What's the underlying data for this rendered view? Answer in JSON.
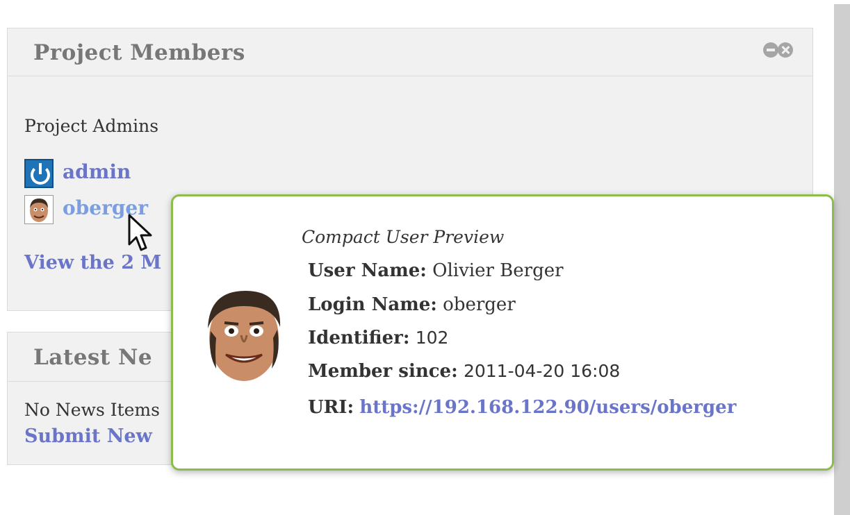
{
  "members_panel": {
    "title": "Project Members",
    "section_label": "Project Admins",
    "members": [
      {
        "name": "admin",
        "avatar": "power-icon"
      },
      {
        "name": "oberger",
        "avatar": "user-photo"
      }
    ],
    "view_all_label": "View the 2 M"
  },
  "news_panel": {
    "title": "Latest Ne",
    "empty_text": "No News Items",
    "submit_label": "Submit New"
  },
  "user_preview": {
    "heading": "Compact User Preview",
    "fields": {
      "user_name_label": "User Name:",
      "user_name_value": "Olivier Berger",
      "login_name_label": "Login Name:",
      "login_name_value": "oberger",
      "identifier_label": "Identifier:",
      "identifier_value": "102",
      "member_since_label": "Member since:",
      "member_since_value": "2011-04-20 16:08",
      "uri_label": "URI:",
      "uri_value": "https://192.168.122.90/users/oberger"
    }
  },
  "colors": {
    "link": "#6a74c8",
    "popup_border": "#8cbc4a",
    "panel_bg": "#f1f1f1"
  }
}
